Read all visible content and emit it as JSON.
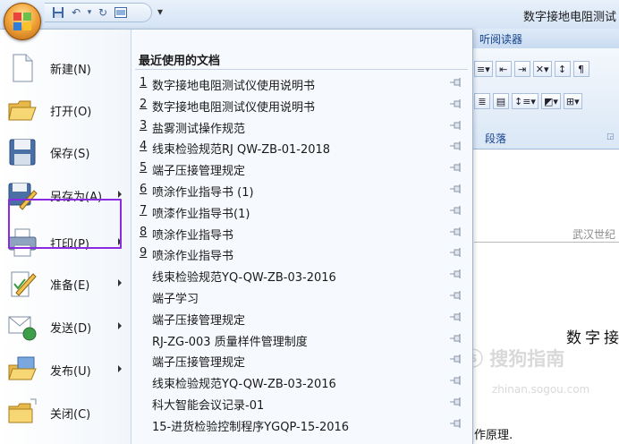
{
  "window": {
    "document_title": "数字接地电阻测试",
    "qat_more": "▾"
  },
  "ribbon": {
    "tab_label": "听阅读器",
    "group_label": "段落"
  },
  "document": {
    "company_header": "武汉世纪",
    "heading": "数字接",
    "body_text": "作原理.",
    "watermark_logo": "ⓢ 搜狗指南",
    "watermark_url": "zhinan.sogou.com"
  },
  "menu": {
    "items": [
      {
        "label": "新建(N)",
        "icon": "new-document-icon",
        "has_submenu": false
      },
      {
        "label": "打开(O)",
        "icon": "open-folder-icon",
        "has_submenu": false
      },
      {
        "label": "保存(S)",
        "icon": "save-disk-icon",
        "has_submenu": false
      },
      {
        "label": "另存为(A)",
        "icon": "save-as-icon",
        "has_submenu": true
      },
      {
        "label": "打印(P)",
        "icon": "printer-icon",
        "has_submenu": true
      },
      {
        "label": "准备(E)",
        "icon": "prepare-icon",
        "has_submenu": true
      },
      {
        "label": "发送(D)",
        "icon": "send-icon",
        "has_submenu": true
      },
      {
        "label": "发布(U)",
        "icon": "publish-icon",
        "has_submenu": true
      },
      {
        "label": "关闭(C)",
        "icon": "close-folder-icon",
        "has_submenu": false
      }
    ],
    "recent_header": "最近使用的文档",
    "recent_docs": [
      {
        "index": "1",
        "name": "数字接地电阻测试仪使用说明书"
      },
      {
        "index": "2",
        "name": "数字接地电阻测试仪使用说明书"
      },
      {
        "index": "3",
        "name": "盐雾测试操作规范"
      },
      {
        "index": "4",
        "name": "线束检验规范RJ QW-ZB-01-2018"
      },
      {
        "index": "5",
        "name": "端子压接管理规定"
      },
      {
        "index": "6",
        "name": "喷涂作业指导书 (1)"
      },
      {
        "index": "7",
        "name": "喷漆作业指导书(1)"
      },
      {
        "index": "8",
        "name": "喷涂作业指导书"
      },
      {
        "index": "9",
        "name": "喷涂作业指导书"
      },
      {
        "index": "",
        "name": "线束检验规范YQ-QW-ZB-03-2016"
      },
      {
        "index": "",
        "name": "端子学习"
      },
      {
        "index": "",
        "name": "端子压接管理规定"
      },
      {
        "index": "",
        "name": "RJ-ZG-003 质量样件管理制度"
      },
      {
        "index": "",
        "name": "端子压接管理规定"
      },
      {
        "index": "",
        "name": "线束检验规范YQ-QW-ZB-03-2016"
      },
      {
        "index": "",
        "name": "科大智能会议记录-01"
      },
      {
        "index": "",
        "name": "15-进货检验控制程序YGQP-15-2016"
      }
    ]
  },
  "colors": {
    "highlight_border": "#8a2be2",
    "menu_background": "#f4f8fd",
    "ribbon_text": "#15428b"
  }
}
